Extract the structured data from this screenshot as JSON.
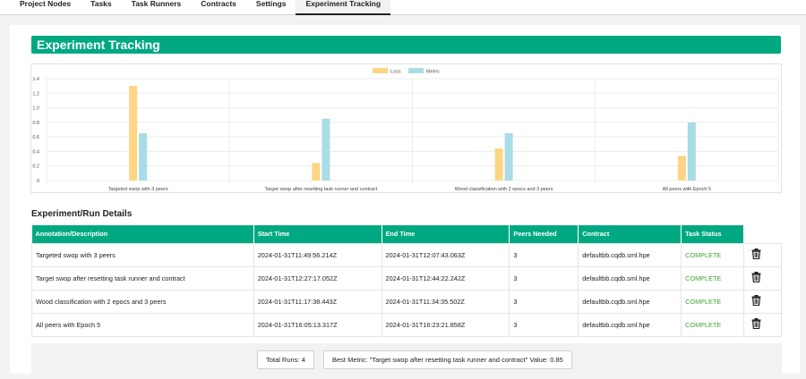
{
  "tabs": [
    {
      "label": "Project Nodes"
    },
    {
      "label": "Tasks"
    },
    {
      "label": "Task Runners"
    },
    {
      "label": "Contracts"
    },
    {
      "label": "Settings"
    },
    {
      "label": "Experiment Tracking",
      "active": true
    }
  ],
  "page": {
    "title": "Experiment Tracking",
    "details_title": "Experiment/Run Details"
  },
  "chart_data": {
    "type": "bar",
    "categories": [
      "Targeted swop with 3 peers",
      "Target swop after resetting task runner and contract",
      "Wood classification with 2 epocs and 3 peers",
      "All peers with Epoch 5"
    ],
    "series": [
      {
        "name": "Loss",
        "color": "#fdd584",
        "values": [
          1.3,
          0.24,
          0.44,
          0.34
        ]
      },
      {
        "name": "Metric",
        "color": "#a9dce6",
        "values": [
          0.65,
          0.85,
          0.65,
          0.8
        ]
      }
    ],
    "ylim": [
      0,
      1.4
    ],
    "yticks": [
      "0",
      "0.2",
      "0.4",
      "0.6",
      "0.8",
      "1.0",
      "1.2",
      "1.4"
    ],
    "legend": "top-center",
    "grid": true
  },
  "table": {
    "columns": [
      "Annotation/Description",
      "Start Time",
      "End Time",
      "Peers Needed",
      "Contract",
      "Task Status"
    ],
    "rows": [
      {
        "desc": "Targeted swop with 3 peers",
        "start": "2024-01-31T11:49:56.214Z",
        "end": "2024-01-31T12:07:43.063Z",
        "peers": "3",
        "contract": "defaultbb.cqdb.sml.hpe",
        "status": "COMPLETE"
      },
      {
        "desc": "Target swop after resetting task runner and contract",
        "start": "2024-01-31T12:27:17.052Z",
        "end": "2024-01-31T12:44:22.242Z",
        "peers": "3",
        "contract": "defaultbb.cqdb.sml.hpe",
        "status": "COMPLETE"
      },
      {
        "desc": "Wood classification with 2 epocs and 3 peers",
        "start": "2024-01-31T11:17:38.443Z",
        "end": "2024-01-31T11:34:35.502Z",
        "peers": "3",
        "contract": "defaultbb.cqdb.sml.hpe",
        "status": "COMPLETE"
      },
      {
        "desc": "All peers with Epoch 5",
        "start": "2024-01-31T16:05:13.317Z",
        "end": "2024-01-31T16:23:21.858Z",
        "peers": "3",
        "contract": "defaultbb.cqdb.sml.hpe",
        "status": "COMPLETE"
      }
    ]
  },
  "footer": {
    "total_runs": "Total Runs: 4",
    "best_metric": "Best Metric: \"Target swop after resetting task runner and contract\" Value: 0.85"
  },
  "icons": {
    "delete": "trash-icon"
  },
  "colors": {
    "accent": "#01a982",
    "status_complete": "#3fa535"
  }
}
